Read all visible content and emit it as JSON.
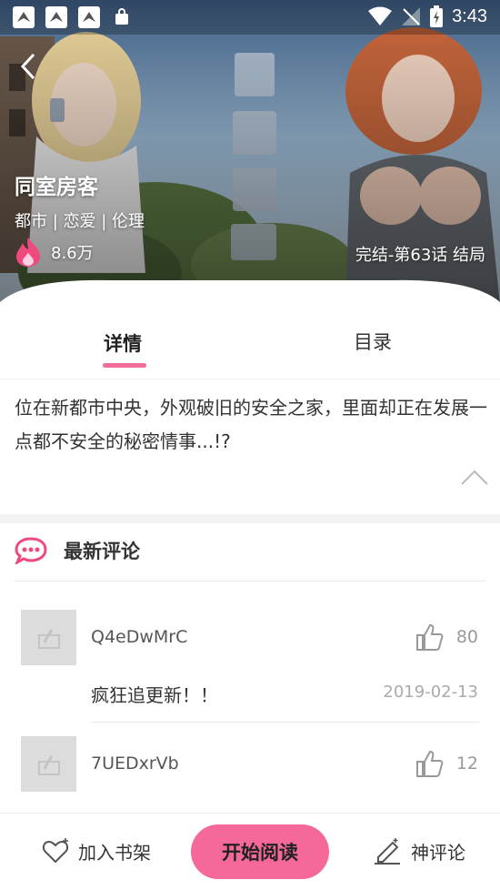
{
  "status_bar": {
    "notification_icons": [
      "bird-icon",
      "bird-icon",
      "bird-icon",
      "shopping-bag-icon"
    ],
    "system_icons": [
      "wifi-icon",
      "cellular-off-icon",
      "battery-charging-icon"
    ],
    "time": "3:43"
  },
  "hero": {
    "title": "同室房客",
    "genres": "都市 | 恋爱 | 伦理",
    "popularity": "8.6万",
    "status": "完结-第63话 结局",
    "back_icon": "chevron-left-icon",
    "hot_icon": "flame-icon"
  },
  "tabs": [
    {
      "label": "详情",
      "active": true
    },
    {
      "label": "目录",
      "active": false
    }
  ],
  "description": "位在新都市中央，外观破旧的安全之家，里面却正在发展一点都不安全的秘密情事...!?",
  "comments": {
    "title": "最新评论",
    "icon": "chat-bubble-icon",
    "items": [
      {
        "user": "Q4eDwMrC",
        "likes": "80",
        "text": "疯狂追更新！！",
        "date": "2019-02-13"
      },
      {
        "user": "7UEDxrVb",
        "likes": "12",
        "text": "",
        "date": ""
      }
    ]
  },
  "bottom_bar": {
    "shelf_label": "加入书架",
    "read_label": "开始阅读",
    "comment_label": "神评论"
  },
  "colors": {
    "accent": "#f4689a",
    "tab_indicator": "#f06c9b",
    "flame": "#f0497e"
  }
}
